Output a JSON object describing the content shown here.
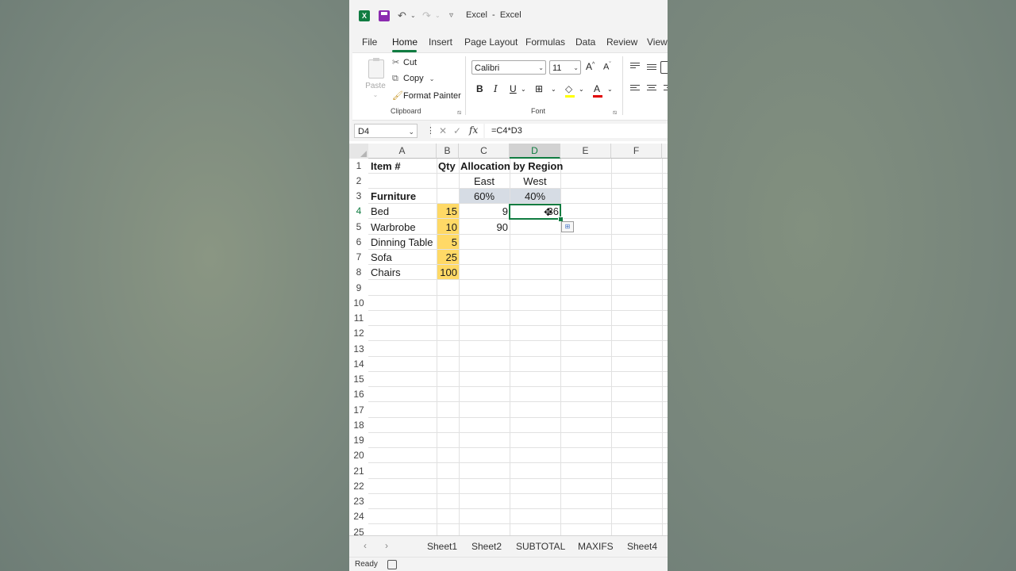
{
  "app": {
    "title": "Excel",
    "title_sep": "-",
    "doc": "Excel"
  },
  "ribbon_tabs": [
    "File",
    "Home",
    "Insert",
    "Page Layout",
    "Formulas",
    "Data",
    "Review",
    "View"
  ],
  "active_tab": "Home",
  "clipboard": {
    "paste": "Paste",
    "cut": "Cut",
    "copy": "Copy",
    "format_painter": "Format Painter",
    "group": "Clipboard"
  },
  "font": {
    "name": "Calibri",
    "size": "11",
    "group": "Font",
    "bold": "B",
    "italic": "I",
    "underline": "U",
    "grow": "A",
    "shrink": "A",
    "color_letter": "A"
  },
  "formula_bar": {
    "name_box": "D4",
    "fx": "fx",
    "formula": "=C4*D3"
  },
  "columns": [
    "A",
    "B",
    "C",
    "D",
    "E",
    "F"
  ],
  "selected_column": "D",
  "rows": [
    "1",
    "2",
    "3",
    "4",
    "5",
    "6",
    "7",
    "8",
    "9",
    "10",
    "11",
    "12",
    "13",
    "14",
    "15",
    "16",
    "17",
    "18",
    "19",
    "20",
    "21",
    "22",
    "23",
    "24",
    "25"
  ],
  "selected_row": "4",
  "cells": {
    "A1": "Item #",
    "B1": "Qty",
    "C1": "Allocation by Region",
    "C2": "East",
    "D2": "West",
    "A3": "Furniture",
    "C3": "60%",
    "D3": "40%",
    "A4": "Bed",
    "B4": "15",
    "C4": "9",
    "D4": "36",
    "A5": "Warbrobe",
    "B5": "10",
    "C5": "90",
    "A6": "Dinning Table",
    "B6": "5",
    "A7": "Sofa",
    "B7": "25",
    "A8": "Chairs",
    "B8": "100"
  },
  "sheets": [
    "Sheet1",
    "Sheet2",
    "SUBTOTAL",
    "MAXIFS",
    "Sheet4"
  ],
  "status": "Ready",
  "colors": {
    "accent": "#107c41",
    "qty_fill": "#ffd966",
    "region_fill": "#d6dce4",
    "save_icon": "#8b2bb0"
  }
}
